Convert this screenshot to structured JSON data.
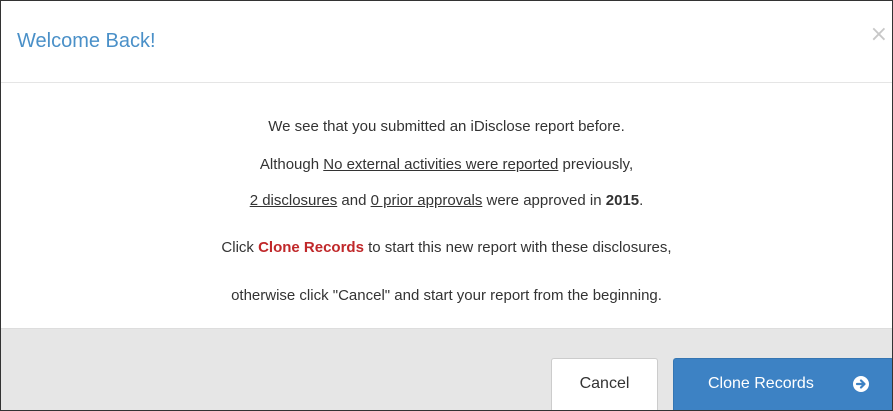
{
  "modal": {
    "title": "Welcome Back!",
    "close_symbol": "×"
  },
  "body": {
    "line1": "We see that you submitted an iDisclose report before.",
    "line2": {
      "prefix": "Although ",
      "link": "No external activities were reported",
      "suffix": " previously,"
    },
    "line3": {
      "disclosures_count": "2 disclosures",
      "and_text": " and ",
      "approvals_count": "0 prior approvals",
      "approved_text": " were approved in ",
      "year": "2015",
      "period": "."
    },
    "line4": {
      "prefix": "Click ",
      "action": "Clone Records",
      "suffix": " to start this new report with these disclosures,"
    },
    "line5": "otherwise click \"Cancel\" and start your report from the beginning."
  },
  "footer": {
    "cancel_label": "Cancel",
    "clone_label": "Clone Records",
    "clone_icon": "arrow-circle-right-icon"
  },
  "colors": {
    "title": "#4a90c8",
    "accent_red": "#c0282a",
    "primary_button": "#3d82c4",
    "footer_bg": "#e6e6e6"
  }
}
